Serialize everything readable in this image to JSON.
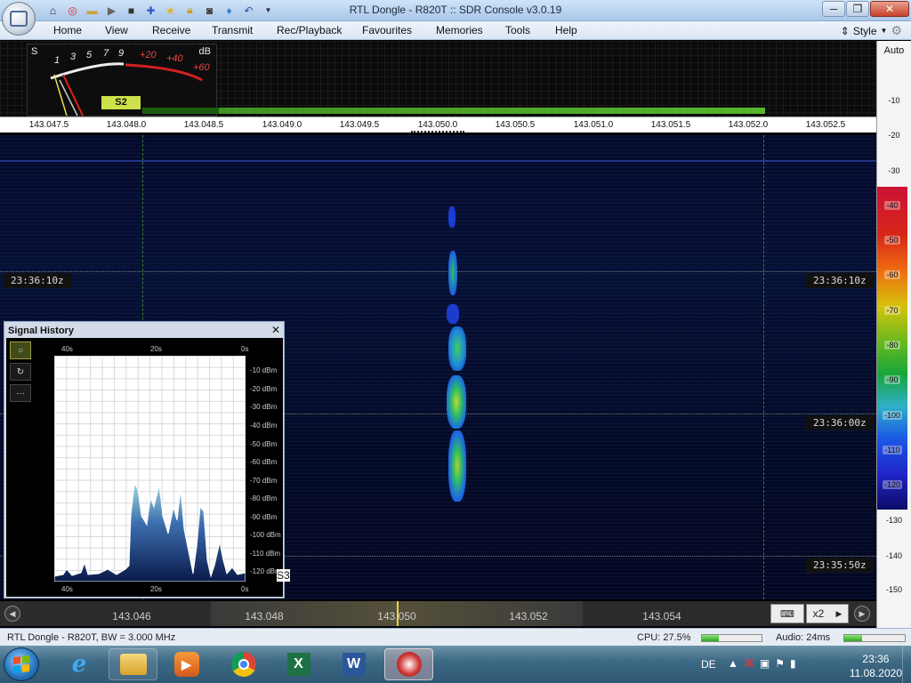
{
  "window": {
    "title": "RTL Dongle - R820T :: SDR Console v3.0.19",
    "quick_access": [
      "home-icon",
      "lifebuoy-icon",
      "folder-icon",
      "play-icon",
      "stop-icon",
      "add-icon",
      "favourite-star-icon",
      "lock-icon",
      "camera-icon",
      "signal-icon",
      "undo-icon",
      "dropdown-icon"
    ]
  },
  "menu": {
    "items": [
      "Home",
      "View",
      "Receive",
      "Transmit",
      "Rec/Playback",
      "Favourites",
      "Memories",
      "Tools",
      "Help"
    ],
    "style_label": "Style"
  },
  "smeter": {
    "s_label": "S",
    "db_label": "dB",
    "scale_s": [
      "1",
      "3",
      "5",
      "7",
      "9"
    ],
    "scale_db": [
      "+20",
      "+40",
      "+60"
    ],
    "reading": "S2"
  },
  "ruler": {
    "ticks": [
      "143.047.5",
      "143.048.0",
      "143.048.5",
      "143.049.0",
      "143.049.5",
      "143.050.0",
      "143.050.5",
      "143.051.0",
      "143.051.5",
      "143.052.0",
      "143.052.5"
    ]
  },
  "waterfall": {
    "time_labels": [
      "23:36:10z",
      "23:36:00z",
      "23:35:50z"
    ]
  },
  "level_scale": {
    "auto_label": "Auto",
    "top_marks": [
      "-10",
      "-20",
      "-30"
    ],
    "bottom_marks": [
      "-130",
      "-140",
      "-150"
    ],
    "colorbar_marks": [
      "-40",
      "-50",
      "-60",
      "-70",
      "-80",
      "-90",
      "-100",
      "-110",
      "-120"
    ]
  },
  "signal_history": {
    "title": "Signal History",
    "close": "✕",
    "tools": [
      "○",
      "↻",
      "···"
    ],
    "time_top": [
      "40s",
      "20s",
      "0s"
    ],
    "time_bottom": [
      "40s",
      "20s",
      "0s"
    ],
    "db_labels": [
      "-10 dBm",
      "-20 dBm",
      "-30 dBm",
      "-40 dBm",
      "-50 dBm",
      "-60 dBm",
      "-70 dBm",
      "-80 dBm",
      "-90 dBm",
      "-100 dBm",
      "-110 dBm",
      "-120 dBm"
    ],
    "s_reading": "S3"
  },
  "tuner": {
    "freqs": [
      "143.046",
      "143.048",
      "143.050",
      "143.052",
      "143.054"
    ],
    "zoom": "x2",
    "keyboard_icon": "keyboard-icon"
  },
  "status": {
    "device": "RTL Dongle - R820T, BW = 3.000 MHz",
    "cpu": "CPU: 27.5%",
    "cpu_fill": 0.28,
    "audio": "Audio: 24ms",
    "audio_fill": 0.3
  },
  "taskbar": {
    "apps": [
      "ie-icon",
      "explorer-icon",
      "media-player-icon",
      "chrome-icon",
      "excel-icon",
      "word-icon",
      "sdr-console-icon"
    ],
    "excel_letter": "X",
    "word_letter": "W",
    "language": "DE",
    "time": "23:36",
    "date": "11.08.2020"
  },
  "colors": {
    "waterfall_bg": "#061033",
    "signal_core": "#38d04a",
    "meter_badge": "#cde14a"
  }
}
